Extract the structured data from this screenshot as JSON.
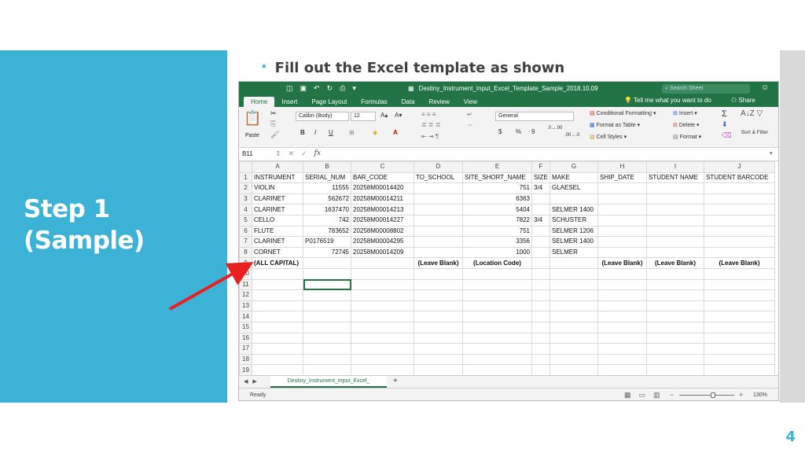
{
  "slide": {
    "title_line1": "Step 1",
    "title_line2": "(Sample)",
    "bullet": "Fill out the Excel template as shown",
    "slide_number": "4",
    "accent_color": "#3cb3d6"
  },
  "excel": {
    "window_title": "Destiny_Instrument_Input_Excel_Template_Sample_2018.10.09",
    "search_placeholder": "Search Sheet",
    "tabs": [
      "Home",
      "Insert",
      "Page Layout",
      "Formulas",
      "Data",
      "Review",
      "View"
    ],
    "active_tab": "Home",
    "tell_me": "Tell me what you want to do",
    "share": "Share",
    "ribbon": {
      "paste": "Paste",
      "font_name": "Calibri (Body)",
      "font_size": "12",
      "bold": "B",
      "italic": "I",
      "underline": "U",
      "number_format": "General",
      "currency": "$",
      "percent": "%",
      "comma": "9",
      "conditional_formatting": "Conditional Formatting",
      "format_as_table": "Format as Table",
      "cell_styles": "Cell Styles",
      "insert": "Insert",
      "delete": "Delete",
      "format": "Format",
      "sort_filter": "Sort & Filter"
    },
    "name_box": "B11",
    "formula_fx": "fx",
    "columns": [
      "A",
      "B",
      "C",
      "D",
      "E",
      "F",
      "G",
      "H",
      "I",
      "J"
    ],
    "rows": [
      [
        "INSTRUMENT",
        "SERIAL_NUM",
        "BAR_CODE",
        "TO_SCHOOL",
        "SITE_SHORT_NAME",
        "SIZE",
        "MAKE",
        "SHIP_DATE",
        "STUDENT NAME",
        "STUDENT BARCODE"
      ],
      [
        "VIOLIN",
        "11555",
        "20258M00014420",
        "",
        "751",
        "3/4",
        "GLAESEL",
        "",
        "",
        ""
      ],
      [
        "CLARINET",
        "562672",
        "20258M00014211",
        "",
        "6363",
        "",
        "",
        "",
        "",
        ""
      ],
      [
        "CLARINET",
        "1637470",
        "20258M00014213",
        "",
        "5404",
        "",
        "SELMER 1400",
        "",
        "",
        ""
      ],
      [
        "CELLO",
        "742",
        "20258M00014227",
        "",
        "7822",
        "3/4",
        "SCHUSTER",
        "",
        "",
        ""
      ],
      [
        "FLUTE",
        "783652",
        "20258M00008802",
        "",
        "751",
        "",
        "SELMER 1206",
        "",
        "",
        ""
      ],
      [
        "CLARINET",
        "P0176519",
        "20258M00004295",
        "",
        "3356",
        "",
        "SELMER 1400",
        "",
        "",
        ""
      ],
      [
        "CORNET",
        "72745",
        "20258M00014209",
        "",
        "1000",
        "",
        "SELMER",
        "",
        "",
        ""
      ],
      [
        "(ALL CAPITAL)",
        "",
        "",
        "(Leave Blank)",
        "(Location Code)",
        "",
        "",
        "(Leave Blank)",
        "(Leave Blank)",
        "(Leave Blank)"
      ],
      [
        "",
        "",
        "",
        "",
        "",
        "",
        "",
        "",
        "",
        ""
      ],
      [
        "",
        "",
        "",
        "",
        "",
        "",
        "",
        "",
        "",
        ""
      ],
      [
        "",
        "",
        "",
        "",
        "",
        "",
        "",
        "",
        "",
        ""
      ],
      [
        "",
        "",
        "",
        "",
        "",
        "",
        "",
        "",
        "",
        ""
      ],
      [
        "",
        "",
        "",
        "",
        "",
        "",
        "",
        "",
        "",
        ""
      ],
      [
        "",
        "",
        "",
        "",
        "",
        "",
        "",
        "",
        "",
        ""
      ],
      [
        "",
        "",
        "",
        "",
        "",
        "",
        "",
        "",
        "",
        ""
      ],
      [
        "",
        "",
        "",
        "",
        "",
        "",
        "",
        "",
        "",
        ""
      ],
      [
        "",
        "",
        "",
        "",
        "",
        "",
        "",
        "",
        "",
        ""
      ],
      [
        "",
        "",
        "",
        "",
        "",
        "",
        "",
        "",
        "",
        ""
      ]
    ],
    "sheet_tab": "Destiny_Instrument_Input_Excel_",
    "status": "Ready",
    "zoom": "130%",
    "colors": {
      "excel_green": "#227447",
      "arrow_red": "#e8201f"
    }
  }
}
